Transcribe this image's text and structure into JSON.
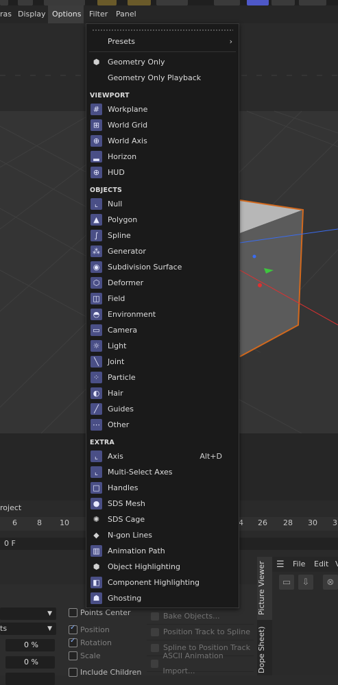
{
  "menubar": {
    "items": [
      {
        "label": "ras",
        "active": false
      },
      {
        "label": "Display",
        "active": false
      },
      {
        "label": "Options",
        "active": true
      },
      {
        "label": "Filter",
        "active": false
      },
      {
        "label": "Panel",
        "active": false
      }
    ]
  },
  "dropdown": {
    "presets": {
      "label": "Presets",
      "submenu_glyph": "›"
    },
    "items_top": [
      {
        "label": "Geometry Only",
        "icon": "cube-icon"
      },
      {
        "label": "Geometry Only Playback",
        "icon": ""
      }
    ],
    "sections": {
      "viewport": "VIEWPORT",
      "objects": "OBJECTS",
      "extra": "EXTRA"
    },
    "viewport_items": [
      {
        "label": "Workplane",
        "icon": "workplane-icon"
      },
      {
        "label": "World Grid",
        "icon": "world-grid-icon"
      },
      {
        "label": "World Axis",
        "icon": "world-axis-icon"
      },
      {
        "label": "Horizon",
        "icon": "horizon-icon"
      },
      {
        "label": "HUD",
        "icon": "hud-icon"
      }
    ],
    "object_items": [
      {
        "label": "Null",
        "icon": "null-icon"
      },
      {
        "label": "Polygon",
        "icon": "polygon-icon"
      },
      {
        "label": "Spline",
        "icon": "spline-icon"
      },
      {
        "label": "Generator",
        "icon": "generator-icon"
      },
      {
        "label": "Subdivision Surface",
        "icon": "subdivision-surface-icon"
      },
      {
        "label": "Deformer",
        "icon": "deformer-icon"
      },
      {
        "label": "Field",
        "icon": "field-icon"
      },
      {
        "label": "Environment",
        "icon": "environment-icon"
      },
      {
        "label": "Camera",
        "icon": "camera-icon"
      },
      {
        "label": "Light",
        "icon": "light-icon"
      },
      {
        "label": "Joint",
        "icon": "joint-icon"
      },
      {
        "label": "Particle",
        "icon": "particle-icon"
      },
      {
        "label": "Hair",
        "icon": "hair-icon"
      },
      {
        "label": "Guides",
        "icon": "guides-icon"
      },
      {
        "label": "Other",
        "icon": "other-icon"
      }
    ],
    "extra_items": [
      {
        "label": "Axis",
        "icon": "axis-icon",
        "shortcut": "Alt+D"
      },
      {
        "label": "Multi-Select Axes",
        "icon": "multi-select-axes-icon",
        "shortcut": ""
      },
      {
        "label": "Handles",
        "icon": "handles-icon",
        "shortcut": ""
      },
      {
        "label": "SDS Mesh",
        "icon": "sds-mesh-icon",
        "shortcut": ""
      },
      {
        "label": "SDS Cage",
        "icon": "sds-cage-icon",
        "shortcut": ""
      },
      {
        "label": "N-gon Lines",
        "icon": "ngon-lines-icon",
        "shortcut": ""
      },
      {
        "label": "Animation Path",
        "icon": "animation-path-icon",
        "shortcut": ""
      },
      {
        "label": "Object Highlighting",
        "icon": "object-highlighting-icon",
        "shortcut": ""
      },
      {
        "label": "Component Highlighting",
        "icon": "component-highlighting-icon",
        "shortcut": ""
      },
      {
        "label": "Ghosting",
        "icon": "ghosting-icon",
        "shortcut": ""
      }
    ]
  },
  "timeline": {
    "project_label": "roject",
    "ticks": [
      "6",
      "8",
      "10",
      "4",
      "26",
      "28",
      "30",
      "3"
    ],
    "frame_value": "0 F"
  },
  "bottom": {
    "points_center": "Points Center",
    "position": "Position",
    "rotation": "Rotation",
    "scale": "Scale",
    "include_children": "Include Children",
    "dropdown2_value": "ts",
    "pct1": "0 %",
    "pct2": "0 %",
    "tools": [
      "Bake Objects...",
      "Position Track to Spline",
      "Spline to Position Track",
      "ASCII Animation Import..."
    ],
    "side_tabs": {
      "picture_viewer": "Picture Viewer",
      "dope_sheet": "Dope Sheet)"
    },
    "pv_menu": {
      "file": "File",
      "edit": "Edit",
      "more": "V"
    }
  },
  "colors": {
    "menu_bg": "#1a1a1a",
    "icon_bg": "#4a4f86",
    "cube_edge": "#d2691e",
    "axis_red": "#e03030",
    "axis_green": "#3ec63e",
    "axis_blue": "#3a6cf0"
  }
}
